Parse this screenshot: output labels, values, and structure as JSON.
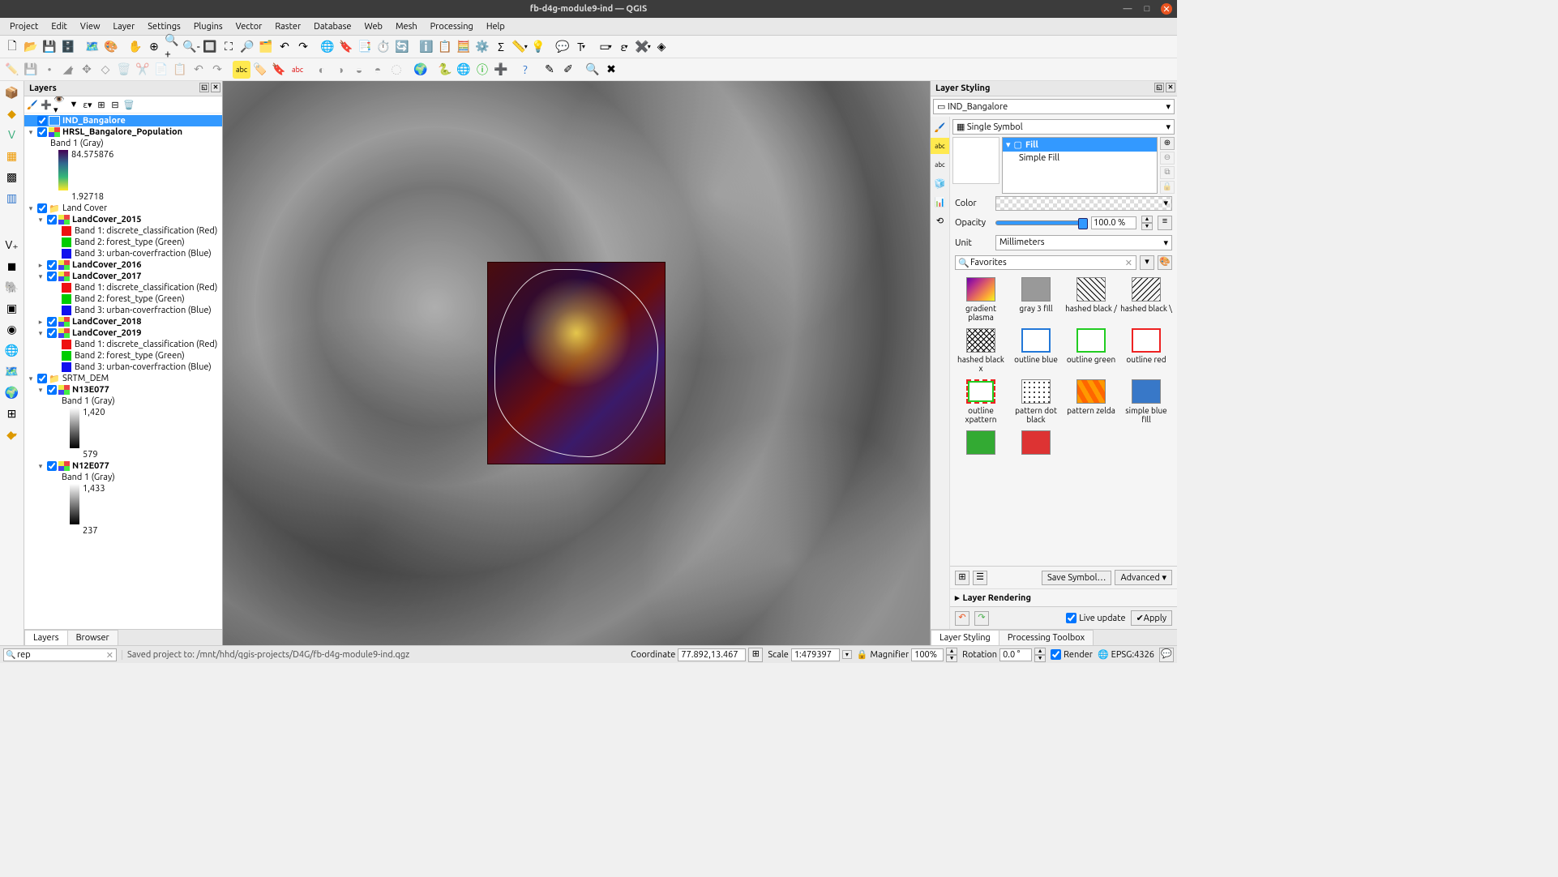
{
  "window": {
    "title": "fb-d4g-module9-ind — QGIS"
  },
  "menus": [
    "Project",
    "Edit",
    "View",
    "Layer",
    "Settings",
    "Plugins",
    "Vector",
    "Raster",
    "Database",
    "Web",
    "Mesh",
    "Processing",
    "Help"
  ],
  "layers_panel": {
    "title": "Layers",
    "tabs": {
      "layers": "Layers",
      "browser": "Browser"
    },
    "tree": {
      "ind": "IND_Bangalore",
      "hrsl": "HRSL_Bangalore_Population",
      "band_gray": "Band 1 (Gray)",
      "hrsl_hi": "84.575876",
      "hrsl_lo": "1.92718",
      "landcover_grp": "Land Cover",
      "lc2015": "LandCover_2015",
      "lc2016": "LandCover_2016",
      "lc2017": "LandCover_2017",
      "lc2018": "LandCover_2018",
      "lc2019": "LandCover_2019",
      "b1": "Band 1: discrete_classification (Red)",
      "b2": "Band 2: forest_type (Green)",
      "b3": "Band 3: urban-coverfraction (Blue)",
      "srtm": "SRTM_DEM",
      "n13": "N13E077",
      "n13_hi": "1,420",
      "n13_lo": "579",
      "n12": "N12E077",
      "n12_hi": "1,433",
      "n12_lo": "237"
    }
  },
  "styling": {
    "title": "Layer Styling",
    "layer": "IND_Bangalore",
    "symbol_type": "Single Symbol",
    "fill_header": "Fill",
    "fill_item": "Simple Fill",
    "labels": {
      "color": "Color",
      "opacity": "Opacity",
      "unit": "Unit"
    },
    "opacity_val": "100.0 %",
    "unit_val": "Millimeters",
    "search": "Favorites",
    "favorites": [
      {
        "name": "gradient plasma",
        "cls": "fav-plasma"
      },
      {
        "name": "gray 3 fill",
        "cls": "fav-gray"
      },
      {
        "name": "hashed black /",
        "cls": "fav-hatch1"
      },
      {
        "name": "hashed black \\",
        "cls": "fav-hatch2"
      },
      {
        "name": "hashed black x",
        "cls": "fav-hatchx"
      },
      {
        "name": "outline blue",
        "cls": "fav-oblue"
      },
      {
        "name": "outline green",
        "cls": "fav-ogreen"
      },
      {
        "name": "outline red",
        "cls": "fav-ored"
      },
      {
        "name": "outline xpattern",
        "cls": "fav-xpat"
      },
      {
        "name": "pattern dot black",
        "cls": "fav-dot"
      },
      {
        "name": "pattern zelda",
        "cls": "fav-zelda"
      },
      {
        "name": "simple blue fill",
        "cls": "fav-sblue"
      },
      {
        "name": "",
        "cls": "fav-sgreen"
      },
      {
        "name": "",
        "cls": "fav-sred"
      }
    ],
    "save_symbol": "Save Symbol…",
    "advanced": "Advanced",
    "layer_rendering": "Layer Rendering",
    "live_update": "Live update",
    "apply": "Apply",
    "tabs": {
      "styling": "Layer Styling",
      "toolbox": "Processing Toolbox"
    }
  },
  "status": {
    "search": "rep",
    "message": "Saved project to: /mnt/hhd/qgis-projects/D4G/fb-d4g-module9-ind.qgz",
    "coordinate_lbl": "Coordinate",
    "coordinate": "77.892,13.467",
    "scale_lbl": "Scale",
    "scale": "1:479397",
    "magnifier_lbl": "Magnifier",
    "magnifier": "100%",
    "rotation_lbl": "Rotation",
    "rotation": "0.0 °",
    "render": "Render",
    "crs": "EPSG:4326"
  }
}
